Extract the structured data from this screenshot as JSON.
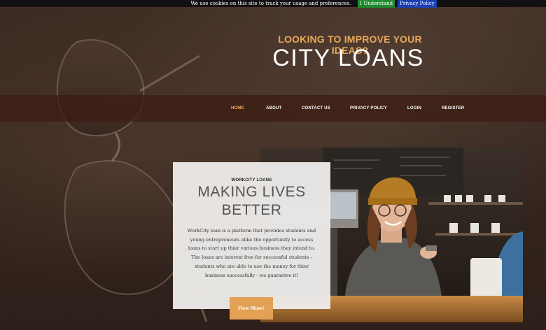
{
  "cookie_bar": {
    "message": "We use cookies on this site to track your usage and preferences.",
    "understand_label": "I Understand",
    "policy_label": "Privacy Policy"
  },
  "header": {
    "tagline": "LOOKING TO IMPROVE YOUR IDEAS?",
    "brand": "CITY LOANS"
  },
  "nav": {
    "items": [
      {
        "label": "HOME",
        "active": true
      },
      {
        "label": "ABOUT"
      },
      {
        "label": "CONTACT US"
      },
      {
        "label": "PRIVACY POLICY"
      },
      {
        "label": "LOGIN"
      },
      {
        "label": "REGISTER"
      }
    ]
  },
  "card": {
    "kicker": "WORKCITY LOANS",
    "title_line1": "MAKING LIVES",
    "title_line2": "BETTER",
    "paragraph1": "WorkCity loan is a platform that provides students and young entrepreneurs alike the opportunity to access loans to start up thier various business they intend to.",
    "paragraph2": "The loans are interest free for successful students - students who are able to use the money for thier business successfully - we guarantee it!",
    "button_label": "View More!"
  },
  "colors": {
    "accent": "#e8a958",
    "button": "#e2a154",
    "nav_band": "#3c1c12",
    "cookie_ok": "#1f8a2e",
    "cookie_policy": "#1a3fb5"
  }
}
